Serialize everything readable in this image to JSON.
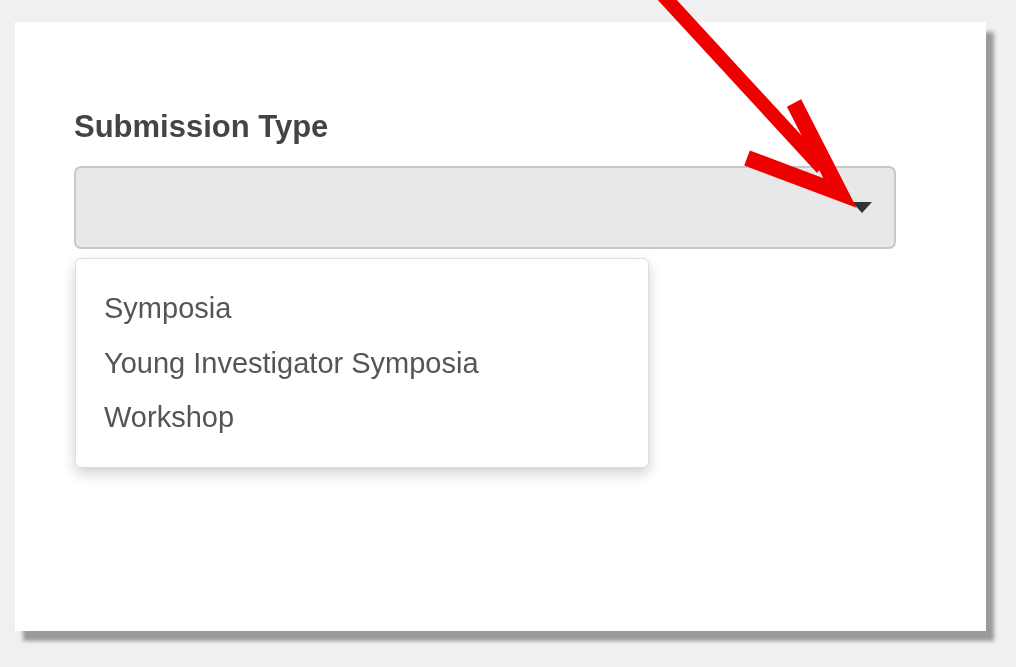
{
  "form": {
    "label": "Submission Type",
    "expanded": true,
    "options": [
      {
        "label": "Symposia",
        "selected": false
      },
      {
        "label": "Young Investigator Symposia",
        "selected": false
      },
      {
        "label": "Workshop",
        "selected": false
      }
    ]
  }
}
